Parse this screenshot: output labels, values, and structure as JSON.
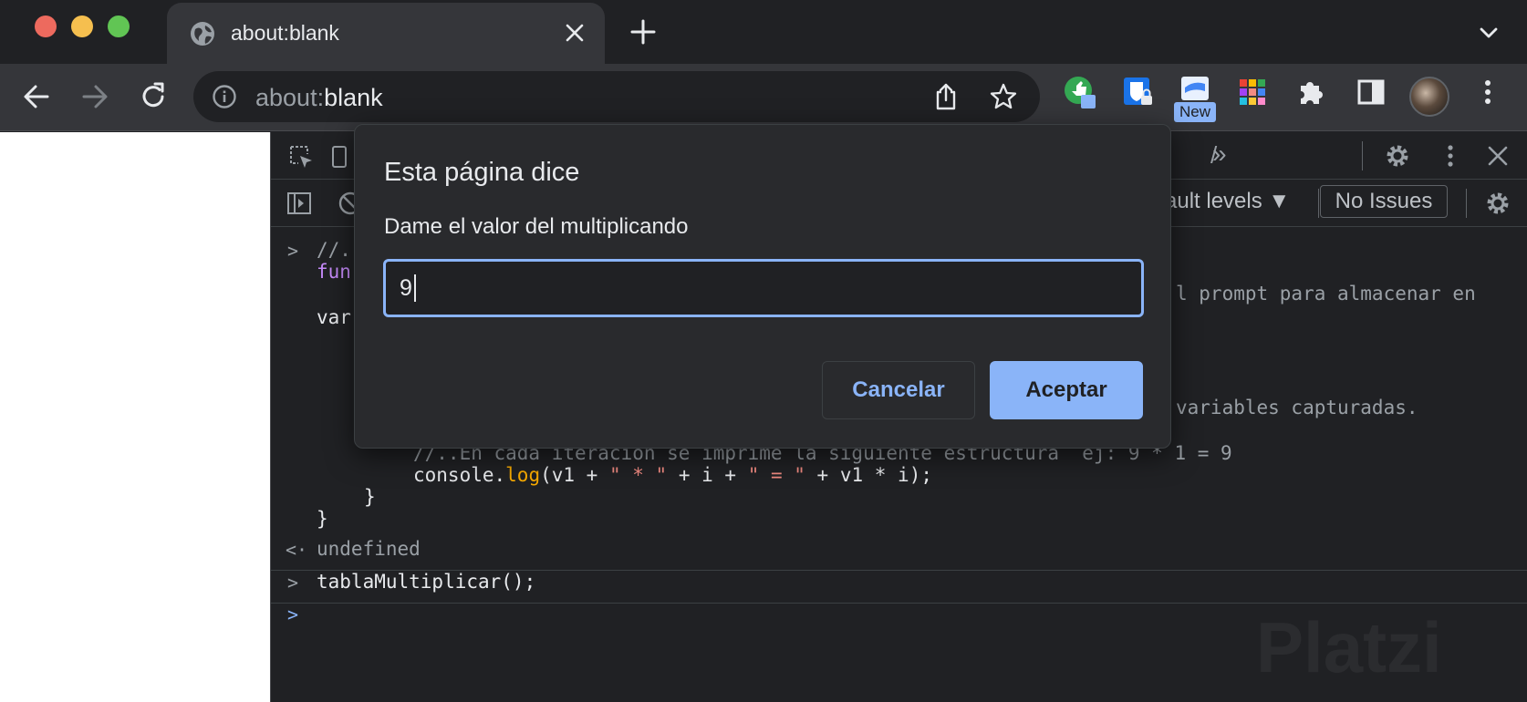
{
  "tab": {
    "title": "about:blank"
  },
  "omnibox": {
    "scheme": "about:",
    "host": "blank"
  },
  "extensions": {
    "new_badge": "New"
  },
  "devtools": {
    "levels": "ault levels ▼",
    "issues": "No Issues",
    "console": {
      "lines": {
        "l1": "//..",
        "l2": "fun",
        "l3_tail": "l prompt para almacenar en",
        "l4": "var",
        "l5_tail": "variables capturadas.",
        "l6": "//..En cada iteracion se imprime la siguiente estructura  ej: 9 * 1 = 9",
        "l7_pre": "console.",
        "l7_log": "log",
        "l7_open": "(v1 + ",
        "l7_s1": "\" * \"",
        "l7_mid": " + i + ",
        "l7_s2": "\" = \"",
        "l7_end": " + v1 * i);",
        "l8": "}",
        "l9": "}"
      },
      "result": "undefined",
      "command": "tablaMultiplicar();"
    },
    "watermark": "Platzi"
  },
  "dialog": {
    "title": "Esta página dice",
    "message": "Dame el valor del multiplicando",
    "input_value": "9",
    "cancel_label": "Cancelar",
    "ok_label": "Aceptar"
  },
  "colors": {
    "accent": "#8ab4f8",
    "dark_bg": "#202124",
    "toolbar_bg": "#35363a"
  },
  "icons": [
    "globe-icon",
    "close-icon",
    "plus-icon",
    "chevron-down-icon",
    "back-arrow-icon",
    "forward-arrow-icon",
    "reload-icon",
    "info-icon",
    "share-icon",
    "star-icon",
    "puzzle-icon",
    "sidepanel-icon",
    "menu-icon",
    "gear-icon"
  ]
}
